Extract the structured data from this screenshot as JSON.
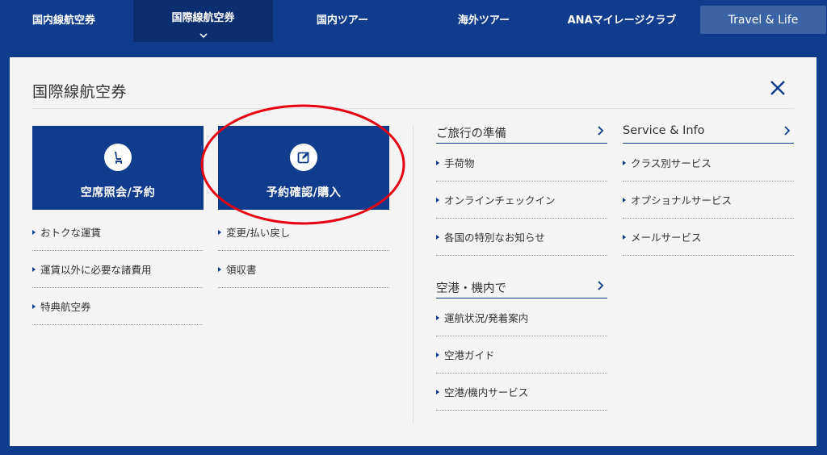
{
  "nav": {
    "items": [
      {
        "label": "国内線航空券"
      },
      {
        "label": "国際線航空券"
      },
      {
        "label": "国内ツアー"
      },
      {
        "label": "海外ツアー"
      },
      {
        "label": "ANAマイレージクラブ"
      },
      {
        "label": "Travel & Life"
      }
    ],
    "active_index": 1
  },
  "panel": {
    "title": "国際線航空券",
    "buttons": [
      {
        "label": "空席照会/予約",
        "icon": "seat-icon"
      },
      {
        "label": "予約確認/購入",
        "icon": "edit-icon"
      }
    ],
    "col1_links": [
      {
        "label": "おトクな運賃"
      },
      {
        "label": "運賃以外に必要な諸費用"
      },
      {
        "label": "特典航空券"
      }
    ],
    "col2_links": [
      {
        "label": "変更/払い戻し"
      },
      {
        "label": "領収書"
      }
    ],
    "section_prep": {
      "title": "ご旅行の準備",
      "links": [
        {
          "label": "手荷物"
        },
        {
          "label": "オンラインチェックイン"
        },
        {
          "label": "各国の特別なお知らせ"
        }
      ]
    },
    "section_airport": {
      "title": "空港・機内で",
      "links": [
        {
          "label": "運航状況/発着案内"
        },
        {
          "label": "空港ガイド"
        },
        {
          "label": "空港/機内サービス"
        }
      ]
    },
    "section_service": {
      "title": "Service & Info",
      "links": [
        {
          "label": "クラス別サービス"
        },
        {
          "label": "オプショナルサービス"
        },
        {
          "label": "メールサービス"
        }
      ]
    }
  },
  "colors": {
    "brand": "#0f3c8c",
    "brand_dark": "#0b2e6e",
    "panel_bg": "#f4f4f4",
    "annotation": "#e60012"
  }
}
